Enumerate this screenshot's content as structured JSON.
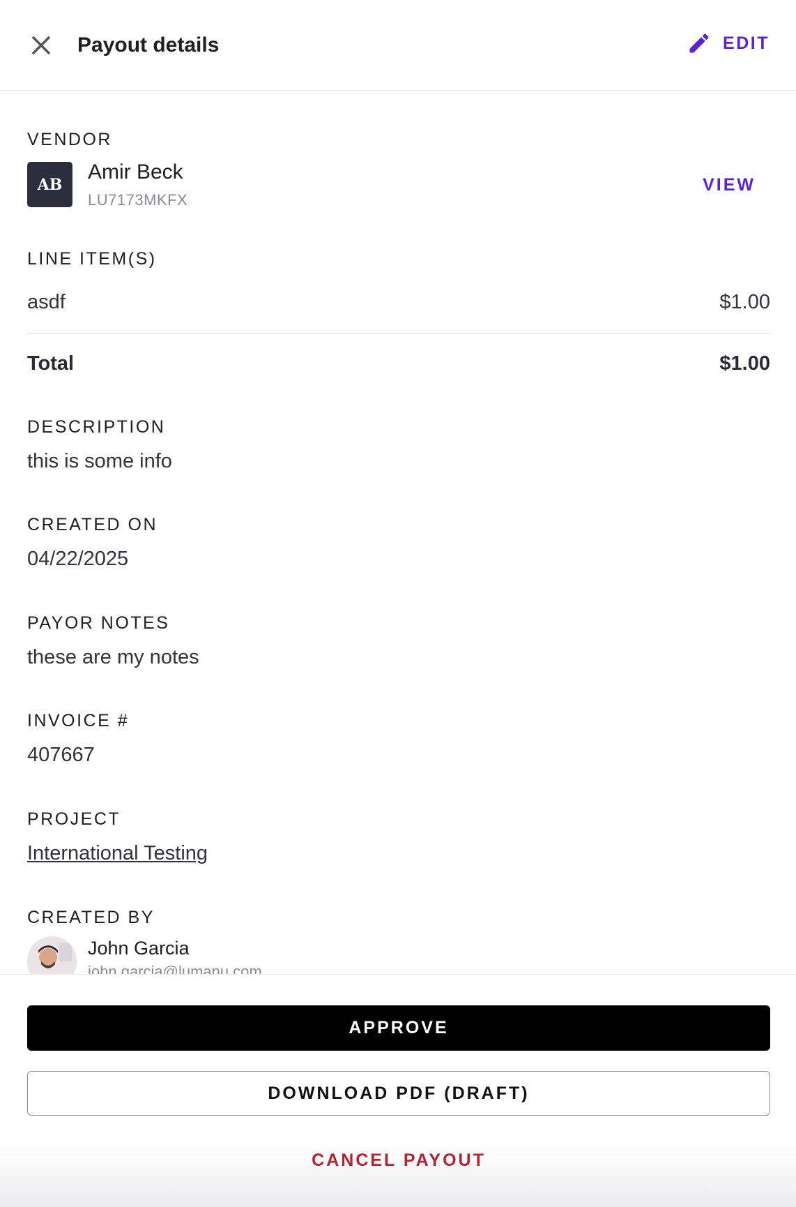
{
  "header": {
    "title": "Payout details",
    "edit_label": "EDIT"
  },
  "vendor": {
    "section_label": "VENDOR",
    "initials": "AB",
    "name": "Amir Beck",
    "id": "LU7173MKFX",
    "view_label": "VIEW"
  },
  "line_items": {
    "section_label": "LINE ITEM(S)",
    "items": [
      {
        "name": "asdf",
        "amount": "$1.00"
      }
    ],
    "total_label": "Total",
    "total_amount": "$1.00"
  },
  "description": {
    "label": "DESCRIPTION",
    "value": "this is some info"
  },
  "created_on": {
    "label": "CREATED ON",
    "value": "04/22/2025"
  },
  "payor_notes": {
    "label": "PAYOR NOTES",
    "value": "these are my notes"
  },
  "invoice": {
    "label": "INVOICE #",
    "value": "407667"
  },
  "project": {
    "label": "PROJECT",
    "value": "International Testing"
  },
  "created_by": {
    "label": "CREATED BY",
    "name": "John Garcia",
    "email": "john.garcia@lumanu.com"
  },
  "actions": {
    "approve_label": "APPROVE",
    "download_label": "DOWNLOAD PDF (DRAFT)",
    "cancel_label": "CANCEL PAYOUT"
  },
  "colors": {
    "accent": "#5b21d9",
    "danger": "#b42331",
    "primary_button": "#000000"
  },
  "icons": {
    "close": "close-icon",
    "edit": "pencil-icon"
  }
}
